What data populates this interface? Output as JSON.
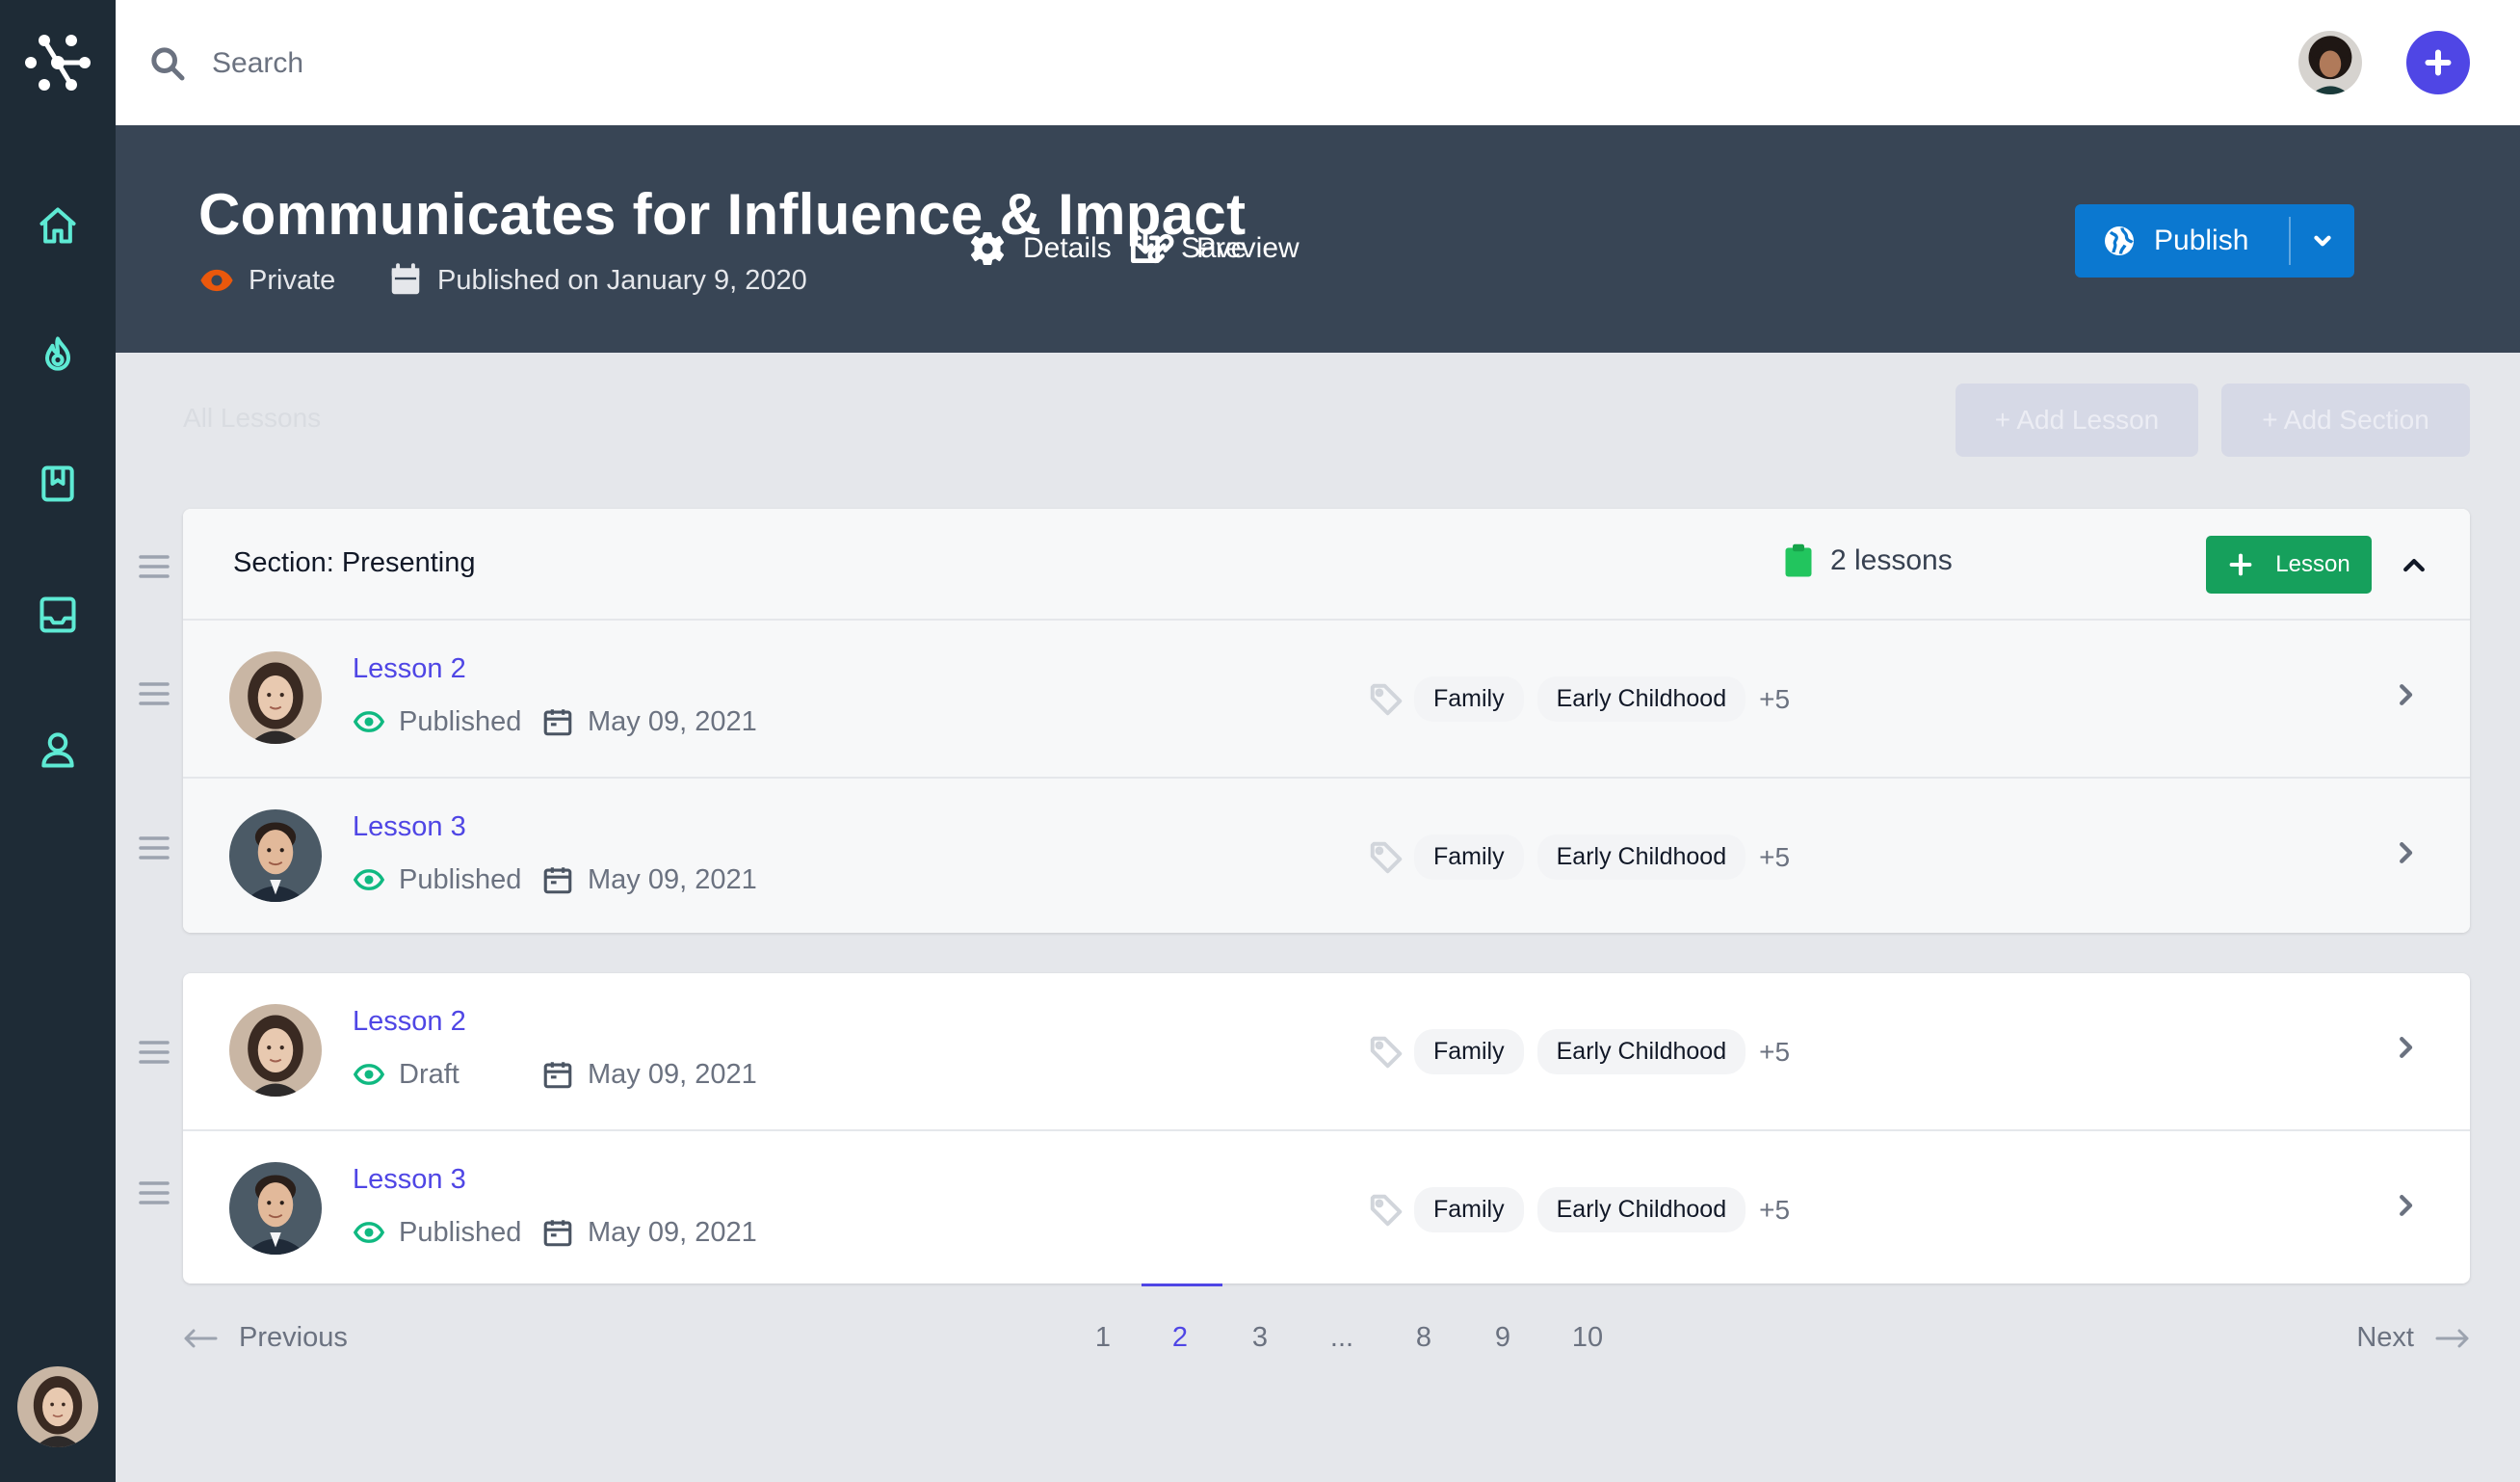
{
  "search": {
    "placeholder": "Search"
  },
  "sidebar": {
    "items": [
      {
        "name": "home",
        "icon": "home-icon"
      },
      {
        "name": "trending",
        "icon": "flame-icon"
      },
      {
        "name": "library",
        "icon": "bookmark-book-icon"
      },
      {
        "name": "inbox",
        "icon": "inbox-icon"
      },
      {
        "name": "profile",
        "icon": "user-icon"
      }
    ]
  },
  "header": {
    "title": "Communicates for Influence & Impact",
    "visibility": "Private",
    "published": "Published on January 9, 2020",
    "details_label": "Details",
    "save_label": "Save",
    "preview_label": "Preview",
    "publish_label": "Publish"
  },
  "toolbar": {
    "all_lessons_label": "All Lessons",
    "add_lesson_label": "+ Add Lesson",
    "add_section_label": "+ Add Section"
  },
  "section": {
    "title": "Section: Presenting",
    "lesson_count": "2 lessons",
    "lesson_button_label": "Lesson",
    "lessons": [
      {
        "name": "Lesson 2",
        "status": "Published",
        "date": "May 09, 2021",
        "tags": [
          "Family",
          "Early Childhood"
        ],
        "more": "+5"
      },
      {
        "name": "Lesson 3",
        "status": "Published",
        "date": "May 09, 2021",
        "tags": [
          "Family",
          "Early Childhood"
        ],
        "more": "+5"
      }
    ]
  },
  "unsectioned": {
    "lessons": [
      {
        "name": "Lesson 2",
        "status": "Draft",
        "date": "May 09, 2021",
        "tags": [
          "Family",
          "Early Childhood"
        ],
        "more": "+5"
      },
      {
        "name": "Lesson 3",
        "status": "Published",
        "date": "May 09, 2021",
        "tags": [
          "Family",
          "Early Childhood"
        ],
        "more": "+5"
      }
    ]
  },
  "pagination": {
    "previous_label": "Previous",
    "next_label": "Next",
    "pages": [
      "1",
      "2",
      "3",
      "...",
      "8",
      "9",
      "10"
    ],
    "current": "2"
  },
  "colors": {
    "sidebar": "#1e2b36",
    "header": "#384555",
    "accent": "#4f46e5",
    "publish": "#0b78d0",
    "success": "#16a05c",
    "private": "#ea580c",
    "status_icon": "#10b981"
  }
}
